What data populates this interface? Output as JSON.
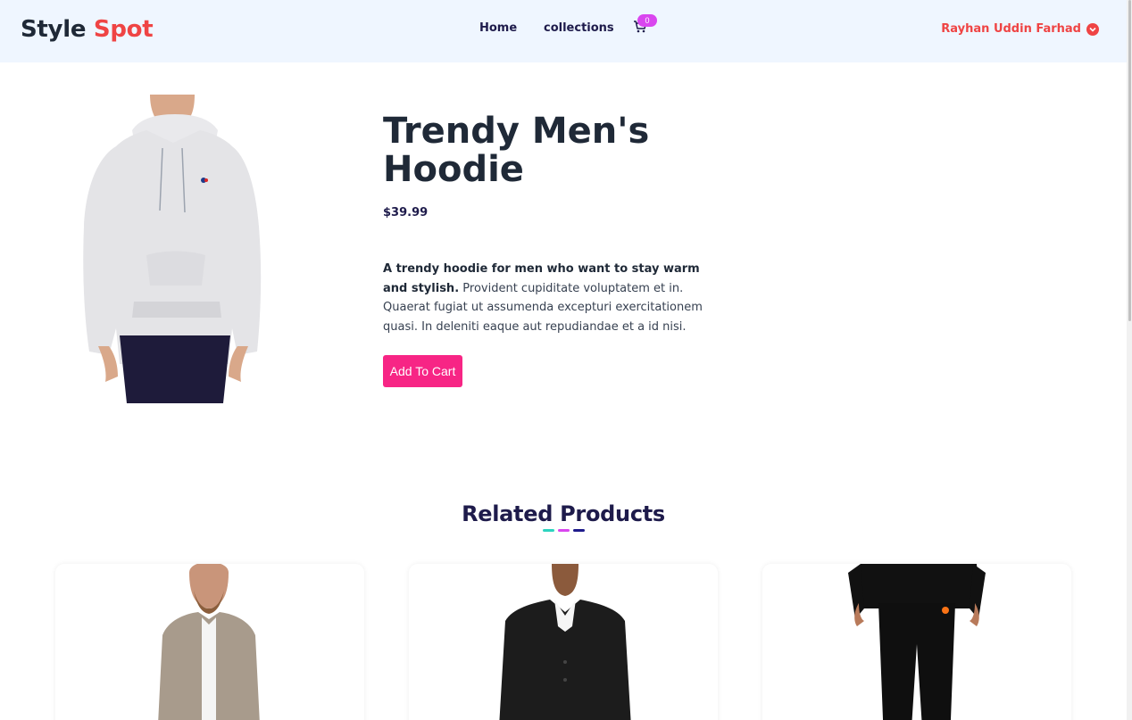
{
  "header": {
    "brand_part1": "Style",
    "brand_part2": "Spot",
    "nav": {
      "home": "Home",
      "collections": "collections"
    },
    "cart_count": "0",
    "user_name": "Rayhan Uddin Farhad"
  },
  "product": {
    "title": "Trendy Men's Hoodie",
    "price": "$39.99",
    "desc_bold": "A trendy hoodie for men who want to stay warm and stylish.",
    "desc_rest": " Provident cupiditate voluptatem et in. Quaerat fugiat ut assumenda excepturi exercitationem quasi. In deleniti eaque aut repudiandae et a id nisi.",
    "add_to_cart": "Add To Cart"
  },
  "related": {
    "title": "Related Products",
    "dash_colors": [
      "#2dd4bf",
      "#d946ef",
      "#1e1b8b"
    ]
  },
  "colors": {
    "accent": "#ef4444",
    "button": "#f72585",
    "badge": "#d946ef",
    "header_bg": "#eff6ff"
  }
}
